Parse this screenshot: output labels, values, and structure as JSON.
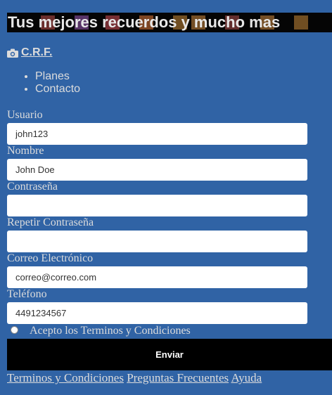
{
  "header": {
    "banner_text": "Tus mejores recuerdos y mucho mas",
    "brand": "C.R.F.",
    "brand_icon": "camera-icon"
  },
  "nav": {
    "items": [
      "Planes",
      "Contacto"
    ]
  },
  "form": {
    "fields": [
      {
        "label": "Usuario",
        "value": "john123"
      },
      {
        "label": "Nombre",
        "value": "John Doe"
      },
      {
        "label": "Contraseña",
        "value": ""
      },
      {
        "label": "Repetir Contraseña",
        "value": ""
      },
      {
        "label": "Correo Electrónico",
        "value": "correo@correo.com"
      },
      {
        "label": "Teléfono",
        "value": "4491234567"
      }
    ],
    "terms_label": "Acepto los Terminos y Condiciones",
    "submit_label": "Enviar"
  },
  "footer": {
    "links": [
      "Terminos y Condiciones",
      "Preguntas Frecuentes",
      "Ayuda"
    ]
  },
  "colors": {
    "background": "#3063a5",
    "banner": "#050505",
    "button": "#000000",
    "text": "#dcdcdc"
  }
}
